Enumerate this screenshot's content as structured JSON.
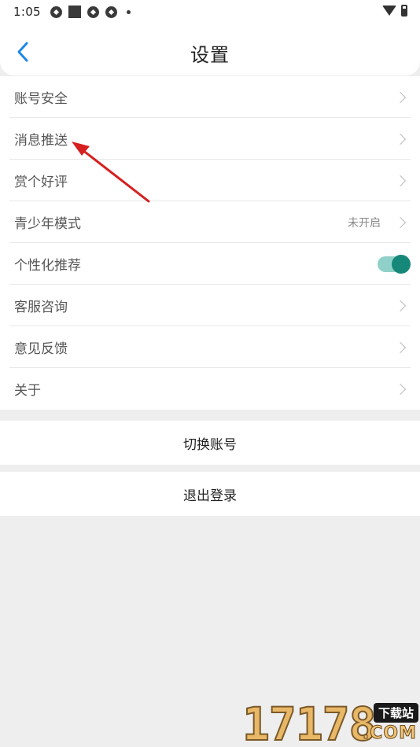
{
  "status_bar": {
    "time": "1:05"
  },
  "header": {
    "title": "设置"
  },
  "settings": {
    "items": [
      {
        "label": "账号安全"
      },
      {
        "label": "消息推送"
      },
      {
        "label": "赏个好评"
      },
      {
        "label": "青少年模式",
        "value": "未开启"
      },
      {
        "label": "个性化推荐",
        "toggle_on": true
      },
      {
        "label": "客服咨询"
      },
      {
        "label": "意见反馈"
      },
      {
        "label": "关于"
      }
    ]
  },
  "actions": {
    "switch_account": "切换账号",
    "logout": "退出登录"
  },
  "watermark": {
    "digits": "17178",
    "badge": "下载站",
    "domain": ".COM"
  },
  "colors": {
    "toggle_accent": "#16887a",
    "back_arrow": "#1e88e5",
    "annotation_arrow": "#d62020"
  }
}
